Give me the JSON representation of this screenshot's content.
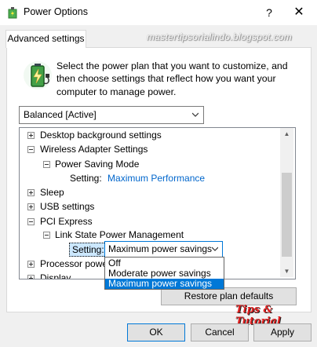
{
  "window": {
    "title": "Power Options",
    "help_label": "?",
    "close_label": "✕"
  },
  "tab": {
    "label": "Advanced settings"
  },
  "watermark": "mastertipsorialindo.blogspot.com",
  "description": "Select the power plan that you want to customize, and then choose settings that reflect how you want your computer to manage power.",
  "plan_select": {
    "value": "Balanced [Active]"
  },
  "tree": {
    "desktop_background": "Desktop background settings",
    "wireless_adapter": "Wireless Adapter Settings",
    "power_saving_mode": "Power Saving Mode",
    "psm_setting_label": "Setting:",
    "psm_setting_value": "Maximum Performance",
    "sleep": "Sleep",
    "usb": "USB settings",
    "pci": "PCI Express",
    "link_state": "Link State Power Management",
    "ls_setting_label": "Setting:",
    "processor": "Processor powe",
    "display": "Display"
  },
  "dropdown": {
    "value": "Maximum power savings",
    "options": [
      "Off",
      "Moderate power savings",
      "Maximum power savings"
    ],
    "selected_index": 2
  },
  "buttons": {
    "restore_label": "Restore plan defaults",
    "ok": "OK",
    "cancel": "Cancel",
    "apply": "Apply"
  },
  "logo_text": "Tips & Tutorial",
  "colors": {
    "accent": "#0078d7",
    "link": "#0066cc",
    "selection_bg": "#cce8ff",
    "logo": "#e02020"
  }
}
